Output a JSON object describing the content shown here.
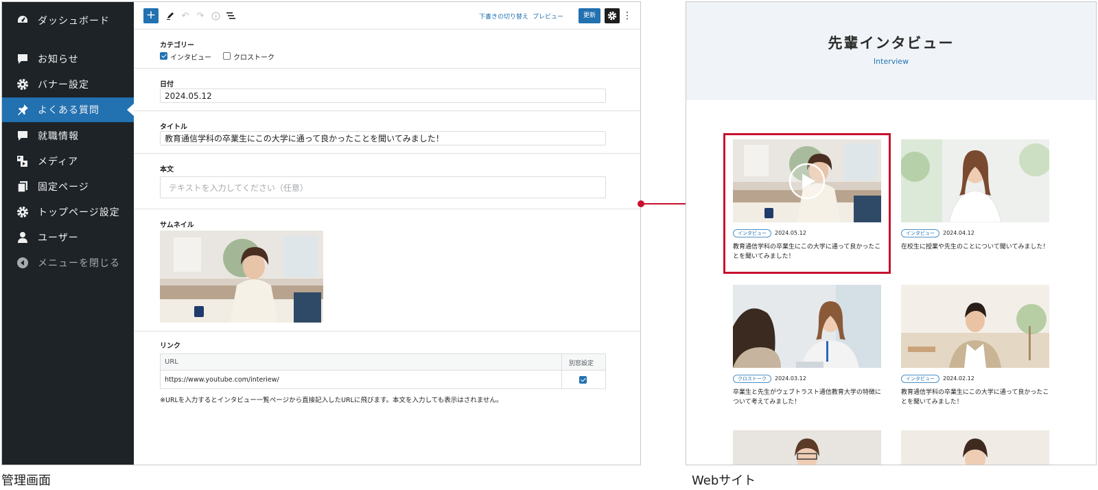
{
  "sidebar": {
    "items": [
      {
        "label": "ダッシュボード",
        "icon": "dashboard-icon"
      },
      {
        "label": "お知らせ",
        "icon": "comment-icon"
      },
      {
        "label": "バナー設定",
        "icon": "gear-icon"
      },
      {
        "label": "よくある質問",
        "icon": "pin-icon",
        "active": true
      },
      {
        "label": "就職情報",
        "icon": "comment-icon"
      },
      {
        "label": "メディア",
        "icon": "media-icon"
      },
      {
        "label": "固定ページ",
        "icon": "pages-icon"
      },
      {
        "label": "トップページ設定",
        "icon": "gear-icon"
      },
      {
        "label": "ユーザー",
        "icon": "user-icon"
      },
      {
        "label": "メニューを閉じる",
        "icon": "collapse-icon"
      }
    ]
  },
  "toolbar": {
    "add_label": "+",
    "draft_switch": "下書きの切り替え",
    "preview": "プレビュー",
    "update": "更新"
  },
  "form": {
    "category_label": "カテゴリー",
    "category_options": [
      {
        "label": "インタビュー",
        "checked": true
      },
      {
        "label": "クロストーク",
        "checked": false
      }
    ],
    "date_label": "日付",
    "date_value": "2024.05.12",
    "title_label": "タイトル",
    "title_value": "教育通信学科の卒業生にこの大学に通って良かったことを聞いてみました！",
    "body_label": "本文",
    "body_placeholder": "テキストを入力してください（任意）",
    "thumbnail_label": "サムネイル",
    "link_label": "リンク",
    "link_col_url": "URL",
    "link_col_window": "別窓設定",
    "link_url": "https://www.youtube.com/interiew/",
    "link_new_window": true,
    "note": "※URLを入力するとインタビュー一覧ページから直接記入したURLに飛びます。本文を入力しても表示はされません。"
  },
  "website": {
    "title": "先輩インタビュー",
    "subtitle": "Interview",
    "cards": [
      {
        "tag": "インタビュー",
        "date": "2024.05.12",
        "title": "教育通信学科の卒業生にこの大学に通って良かったことを聞いてみました！"
      },
      {
        "tag": "インタビュー",
        "date": "2024.04.12",
        "title": "在校生に授業や先生のことについて聞いてみました！"
      },
      {
        "tag": "クロストーク",
        "date": "2024.03.12",
        "title": "卒業生と先生がウェブトラスト通信教育大学の特徴について考えてみました！"
      },
      {
        "tag": "インタビュー",
        "date": "2024.02.12",
        "title": "教育通信学科の卒業生にこの大学に通って良かったことを聞いてみました！"
      }
    ]
  },
  "captions": {
    "admin": "管理画面",
    "website": "Webサイト"
  },
  "colors": {
    "sidebar_bg": "#1d2327",
    "accent": "#2271b1",
    "highlight": "#c8102e",
    "hero_bg": "#f0f4f8"
  }
}
